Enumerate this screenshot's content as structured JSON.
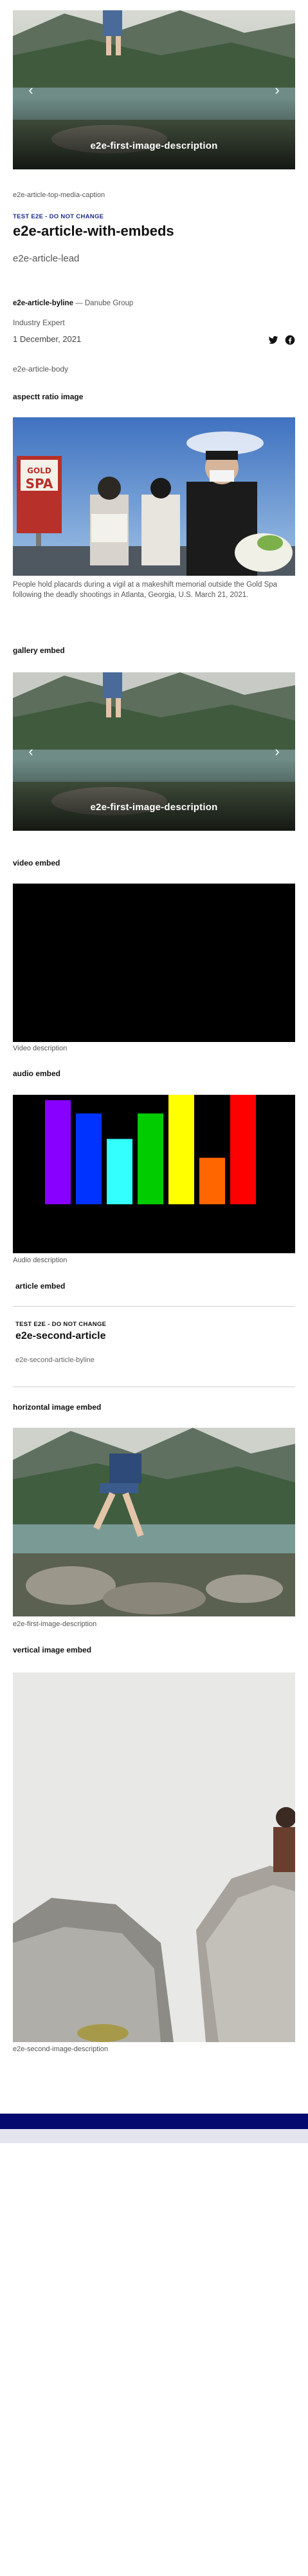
{
  "gallery_top": {
    "caption": "e2e-first-image-description"
  },
  "article": {
    "top_media_caption": "e2e-article-top-media-caption",
    "kicker": "TEST E2E - DO NOT CHANGE",
    "title": "e2e-article-with-embeds",
    "lead": "e2e-article-lead",
    "byline_name": "e2e-article-byline",
    "byline_sep": " — ",
    "byline_org": "Danube Group",
    "byline_role": "Industry Expert",
    "date": "1 December, 2021",
    "body": "e2e-article-body"
  },
  "share": {
    "twitter_icon": "twitter-icon",
    "facebook_icon": "facebook-icon"
  },
  "aspect_section": {
    "title": "aspectt ratio image",
    "caption": "People hold placards during a vigil at a makeshift memorial outside the Gold Spa following the deadly shootings in Atlanta, Georgia, U.S. March 21, 2021.",
    "sign_text": "SPA",
    "sign_text_top": "GOLD"
  },
  "gallery_section": {
    "title": "gallery embed",
    "caption": "e2e-first-image-description"
  },
  "video_section": {
    "title": "video embed",
    "description": "Video description"
  },
  "audio_section": {
    "title": "audio embed",
    "description": "Audio description",
    "bar_colors": [
      "#8800ff",
      "#0033ff",
      "#33ffff",
      "#00cc00",
      "#ffff00",
      "#ff6600",
      "#ff0000"
    ],
    "bar_levels": [
      0.94,
      0.82,
      0.59,
      0.82,
      1.0,
      0.42,
      1.0
    ]
  },
  "article_embed": {
    "title": "article embed",
    "kicker": "TEST E2E - DO NOT CHANGE",
    "headline": "e2e-second-article",
    "byline": "e2e-second-article-byline"
  },
  "horizontal_section": {
    "title": "horizontal image embed",
    "caption": "e2e-first-image-description"
  },
  "vertical_section": {
    "title": "vertical image embed",
    "caption": "e2e-second-image-description"
  },
  "colors": {
    "accent_navy": "#050a6e",
    "footer_light": "#e4e4ef",
    "kicker_blue": "#1a2b8c"
  }
}
